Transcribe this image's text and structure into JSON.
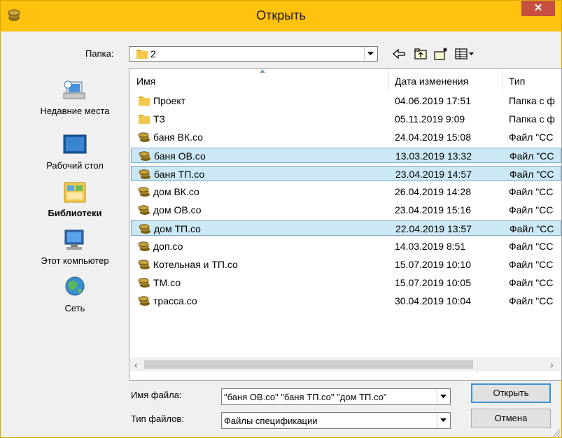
{
  "window": {
    "title": "Открыть",
    "close_glyph": "✕",
    "accent_color": "#ffc20e",
    "close_color": "#c74f41"
  },
  "folder": {
    "label": "Папка:",
    "value": "2",
    "icon": "folder-icon"
  },
  "toolbar": {
    "icons": [
      "back-arrow-icon",
      "up-folder-icon",
      "new-folder-icon",
      "view-menu-icon"
    ]
  },
  "places": [
    {
      "label": "Недавние места",
      "icon": "recent-places-icon"
    },
    {
      "label": "Рабочий стол",
      "icon": "desktop-icon"
    },
    {
      "label": "Библиотеки",
      "icon": "libraries-icon"
    },
    {
      "label": "Этот компьютер",
      "icon": "computer-icon"
    },
    {
      "label": "Сеть",
      "icon": "network-icon"
    }
  ],
  "columns": {
    "name": "Имя",
    "date": "Дата изменения",
    "type": "Тип"
  },
  "files": [
    {
      "name": "Проект",
      "date": "04.06.2019 17:51",
      "type": "Папка с ф",
      "kind": "folder",
      "selected": false
    },
    {
      "name": "ТЗ",
      "date": "05.11.2019 9:09",
      "type": "Папка с ф",
      "kind": "folder",
      "selected": false
    },
    {
      "name": "баня ВК.со",
      "date": "24.04.2019 15:08",
      "type": "Файл \"CC",
      "kind": "file",
      "selected": false
    },
    {
      "name": "баня ОВ.со",
      "date": "13.03.2019 13:32",
      "type": "Файл \"CC",
      "kind": "file",
      "selected": true
    },
    {
      "name": "баня ТП.со",
      "date": "23.04.2019 14:57",
      "type": "Файл \"CC",
      "kind": "file",
      "selected": true
    },
    {
      "name": "дом ВК.со",
      "date": "26.04.2019 14:28",
      "type": "Файл \"CC",
      "kind": "file",
      "selected": false
    },
    {
      "name": "дом ОВ.со",
      "date": "23.04.2019 15:16",
      "type": "Файл \"CC",
      "kind": "file",
      "selected": false
    },
    {
      "name": "дом ТП.со",
      "date": "22.04.2019 13:57",
      "type": "Файл \"CC",
      "kind": "file",
      "selected": true
    },
    {
      "name": "доп.со",
      "date": "14.03.2019 8:51",
      "type": "Файл \"CC",
      "kind": "file",
      "selected": false
    },
    {
      "name": "Котельная и ТП.со",
      "date": "15.07.2019 10:10",
      "type": "Файл \"CC",
      "kind": "file",
      "selected": false
    },
    {
      "name": "ТМ.со",
      "date": "15.07.2019 10:05",
      "type": "Файл \"CC",
      "kind": "file",
      "selected": false
    },
    {
      "name": "трасса.со",
      "date": "30.04.2019 10:04",
      "type": "Файл \"CC",
      "kind": "file",
      "selected": false
    }
  ],
  "filename": {
    "label": "Имя файла:",
    "value": "\"баня ОВ.со\" \"баня ТП.со\" \"дом ТП.со\""
  },
  "filetype": {
    "label": "Тип файлов:",
    "value": "Файлы  спецификации"
  },
  "buttons": {
    "open": "Открыть",
    "cancel": "Отмена"
  },
  "scrollbar": {
    "left_glyph": "‹",
    "right_glyph": "›"
  },
  "colors": {
    "selection_bg": "#cce8f4",
    "selection_border": "#7dabc9"
  }
}
